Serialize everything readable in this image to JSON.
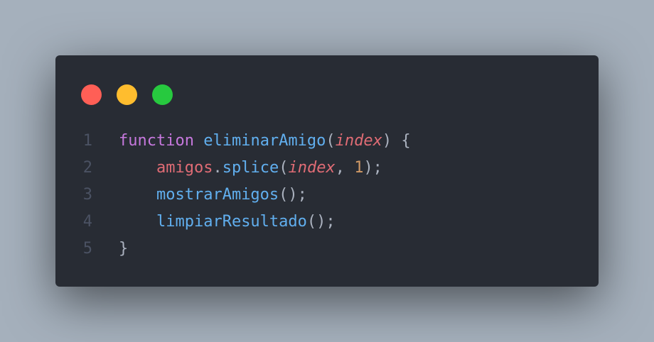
{
  "window": {
    "controls": {
      "close_color": "#ff5f56",
      "minimize_color": "#ffbd2e",
      "maximize_color": "#27c93f"
    }
  },
  "code": {
    "lines": [
      {
        "number": "1",
        "indent": "",
        "tokens": [
          {
            "text": "function",
            "kind": "kw"
          },
          {
            "text": " ",
            "kind": "pun"
          },
          {
            "text": "eliminarAmigo",
            "kind": "fn"
          },
          {
            "text": "(",
            "kind": "pun"
          },
          {
            "text": "index",
            "kind": "param"
          },
          {
            "text": ") {",
            "kind": "pun"
          }
        ]
      },
      {
        "number": "2",
        "indent": "    ",
        "tokens": [
          {
            "text": "amigos",
            "kind": "var"
          },
          {
            "text": ".",
            "kind": "pun"
          },
          {
            "text": "splice",
            "kind": "fn"
          },
          {
            "text": "(",
            "kind": "pun"
          },
          {
            "text": "index",
            "kind": "param"
          },
          {
            "text": ", ",
            "kind": "pun"
          },
          {
            "text": "1",
            "kind": "num"
          },
          {
            "text": ");",
            "kind": "pun"
          }
        ]
      },
      {
        "number": "3",
        "indent": "    ",
        "tokens": [
          {
            "text": "mostrarAmigos",
            "kind": "fn"
          },
          {
            "text": "();",
            "kind": "pun"
          }
        ]
      },
      {
        "number": "4",
        "indent": "    ",
        "tokens": [
          {
            "text": "limpiarResultado",
            "kind": "fn"
          },
          {
            "text": "();",
            "kind": "pun"
          }
        ]
      },
      {
        "number": "5",
        "indent": "",
        "tokens": [
          {
            "text": "}",
            "kind": "pun"
          }
        ]
      }
    ]
  }
}
